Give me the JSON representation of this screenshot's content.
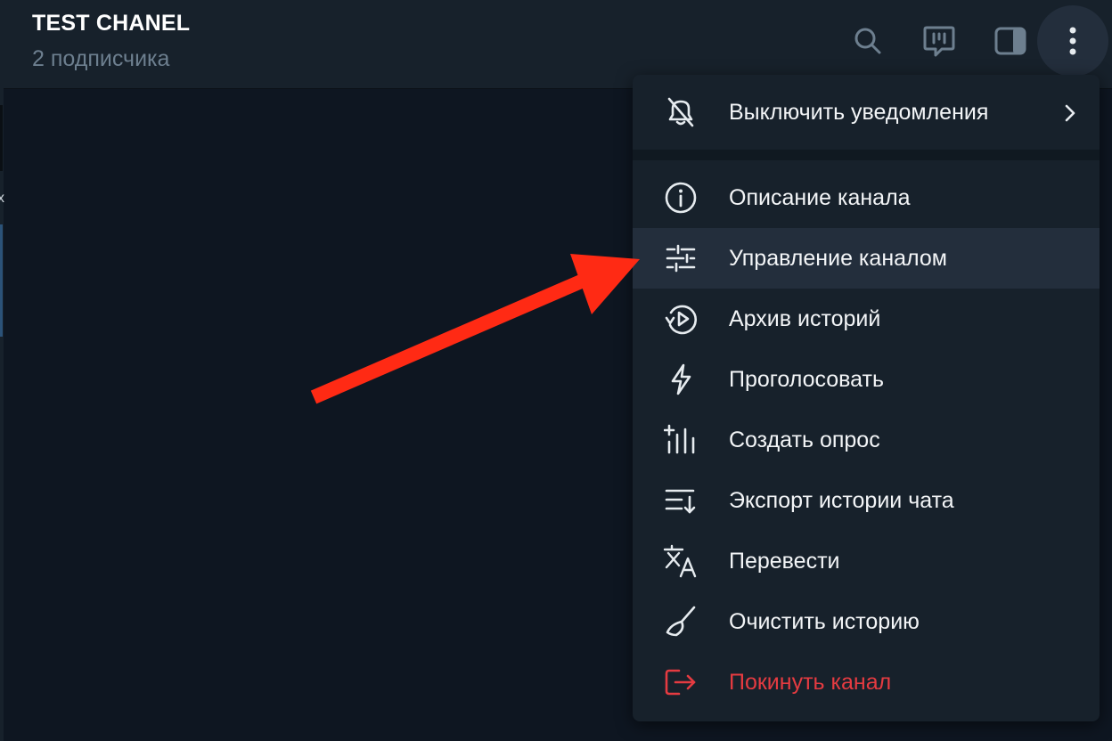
{
  "header": {
    "title": "TEST CHANEL",
    "subtitle": "2 подписчика",
    "buttons": [
      "search-icon",
      "live-stream-icon",
      "sidebar-toggle-icon",
      "more-vertical-icon"
    ]
  },
  "left_edge": {
    "glyph": "x"
  },
  "menu": {
    "items": [
      {
        "label": "Выключить уведомления",
        "icon": "mute-bell-icon",
        "has_submenu": true
      },
      {
        "label": "Описание канала",
        "icon": "info-icon"
      },
      {
        "label": "Управление каналом",
        "icon": "settings-sliders-icon",
        "highlighted": true
      },
      {
        "label": "Архив историй",
        "icon": "stories-archive-icon"
      },
      {
        "label": "Проголосовать",
        "icon": "lightning-icon"
      },
      {
        "label": "Создать опрос",
        "icon": "poll-icon"
      },
      {
        "label": "Экспорт истории чата",
        "icon": "export-icon"
      },
      {
        "label": "Перевести",
        "icon": "translate-icon"
      },
      {
        "label": "Очистить историю",
        "icon": "broom-icon"
      },
      {
        "label": "Покинуть канал",
        "icon": "leave-icon",
        "danger": true
      }
    ]
  },
  "colors": {
    "background": "#0e1621",
    "header": "#17212b",
    "menu": "#17212b",
    "hover": "#232e3c",
    "text": "#f3f5f7",
    "muted": "#6d7f8f",
    "danger": "#e53b41",
    "annotation_arrow": "#ff2a14"
  }
}
